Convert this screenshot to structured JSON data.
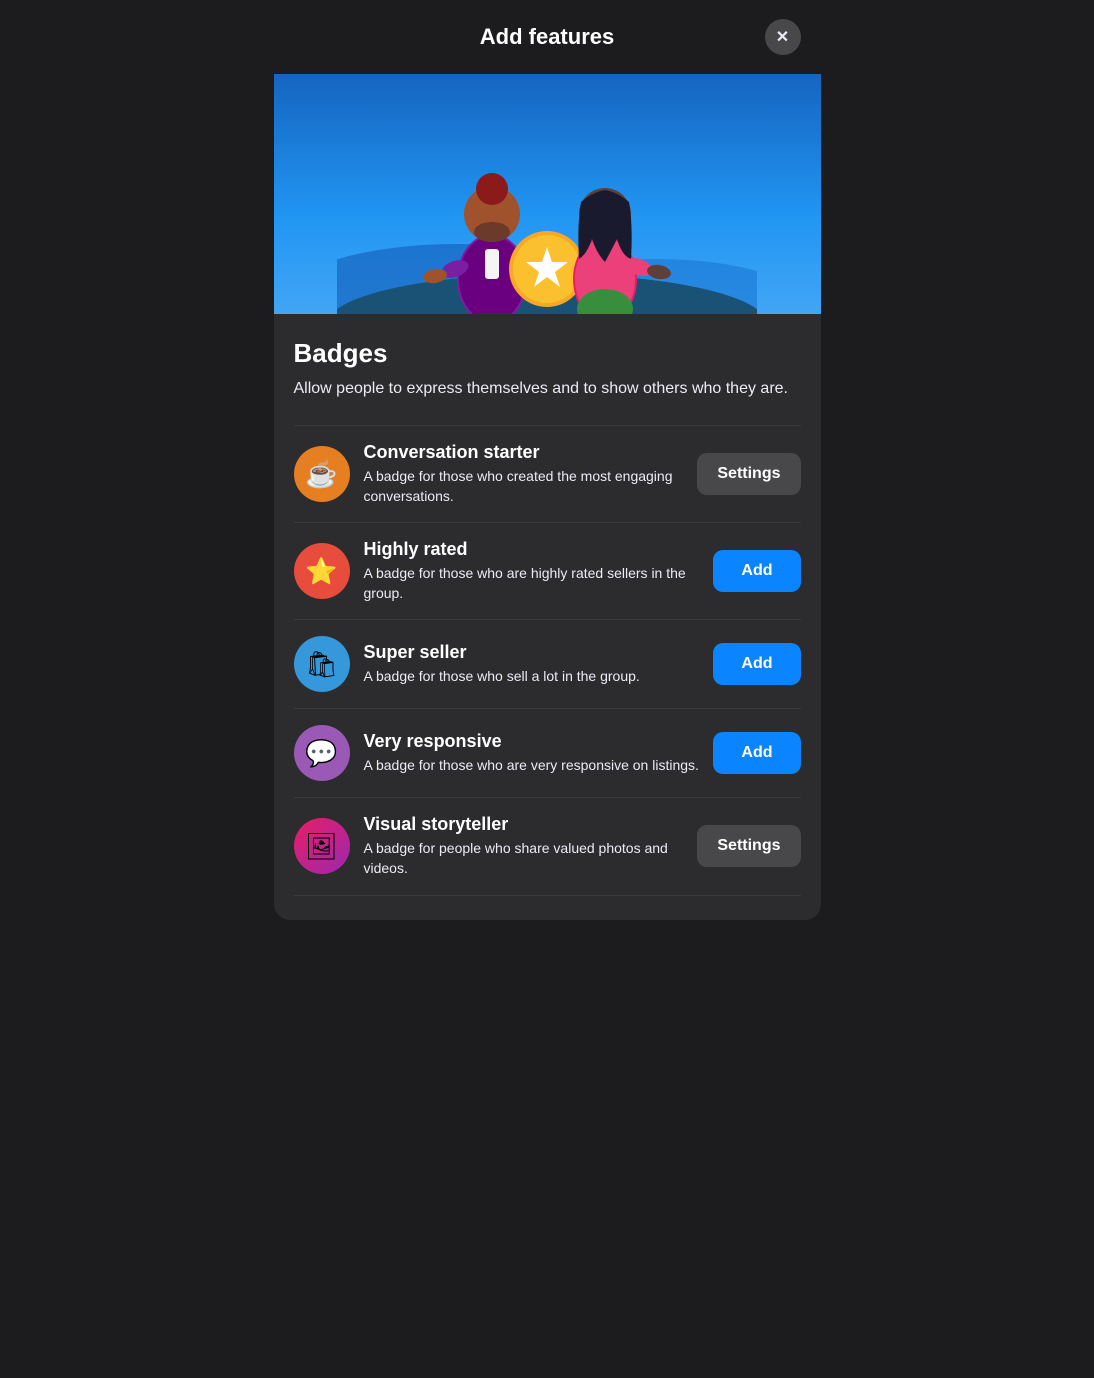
{
  "header": {
    "title": "Add features",
    "close_label": "×"
  },
  "badges": {
    "title": "Badges",
    "description": "Allow people to express themselves and to show others who they are.",
    "items": [
      {
        "id": "conversation-starter",
        "name": "Conversation starter",
        "description": "A badge for those who created the most engaging conversations.",
        "icon": "☕",
        "icon_class": "conversation-starter",
        "action": "Settings",
        "action_type": "settings"
      },
      {
        "id": "highly-rated",
        "name": "Highly rated",
        "description": "A badge for those who are highly rated sellers in the group.",
        "icon": "⭐",
        "icon_class": "highly-rated",
        "action": "Add",
        "action_type": "add"
      },
      {
        "id": "super-seller",
        "name": "Super seller",
        "description": "A badge for those who sell a lot in the group.",
        "icon": "🛍",
        "icon_class": "super-seller",
        "action": "Add",
        "action_type": "add"
      },
      {
        "id": "very-responsive",
        "name": "Very responsive",
        "description": "A badge for those who are very responsive on listings.",
        "icon": "💬",
        "icon_class": "very-responsive",
        "action": "Add",
        "action_type": "add"
      },
      {
        "id": "visual-storyteller",
        "name": "Visual storyteller",
        "description": "A badge for people who share valued photos and videos.",
        "icon": "🖼",
        "icon_class": "visual-storyteller",
        "action": "Settings",
        "action_type": "settings"
      }
    ]
  }
}
